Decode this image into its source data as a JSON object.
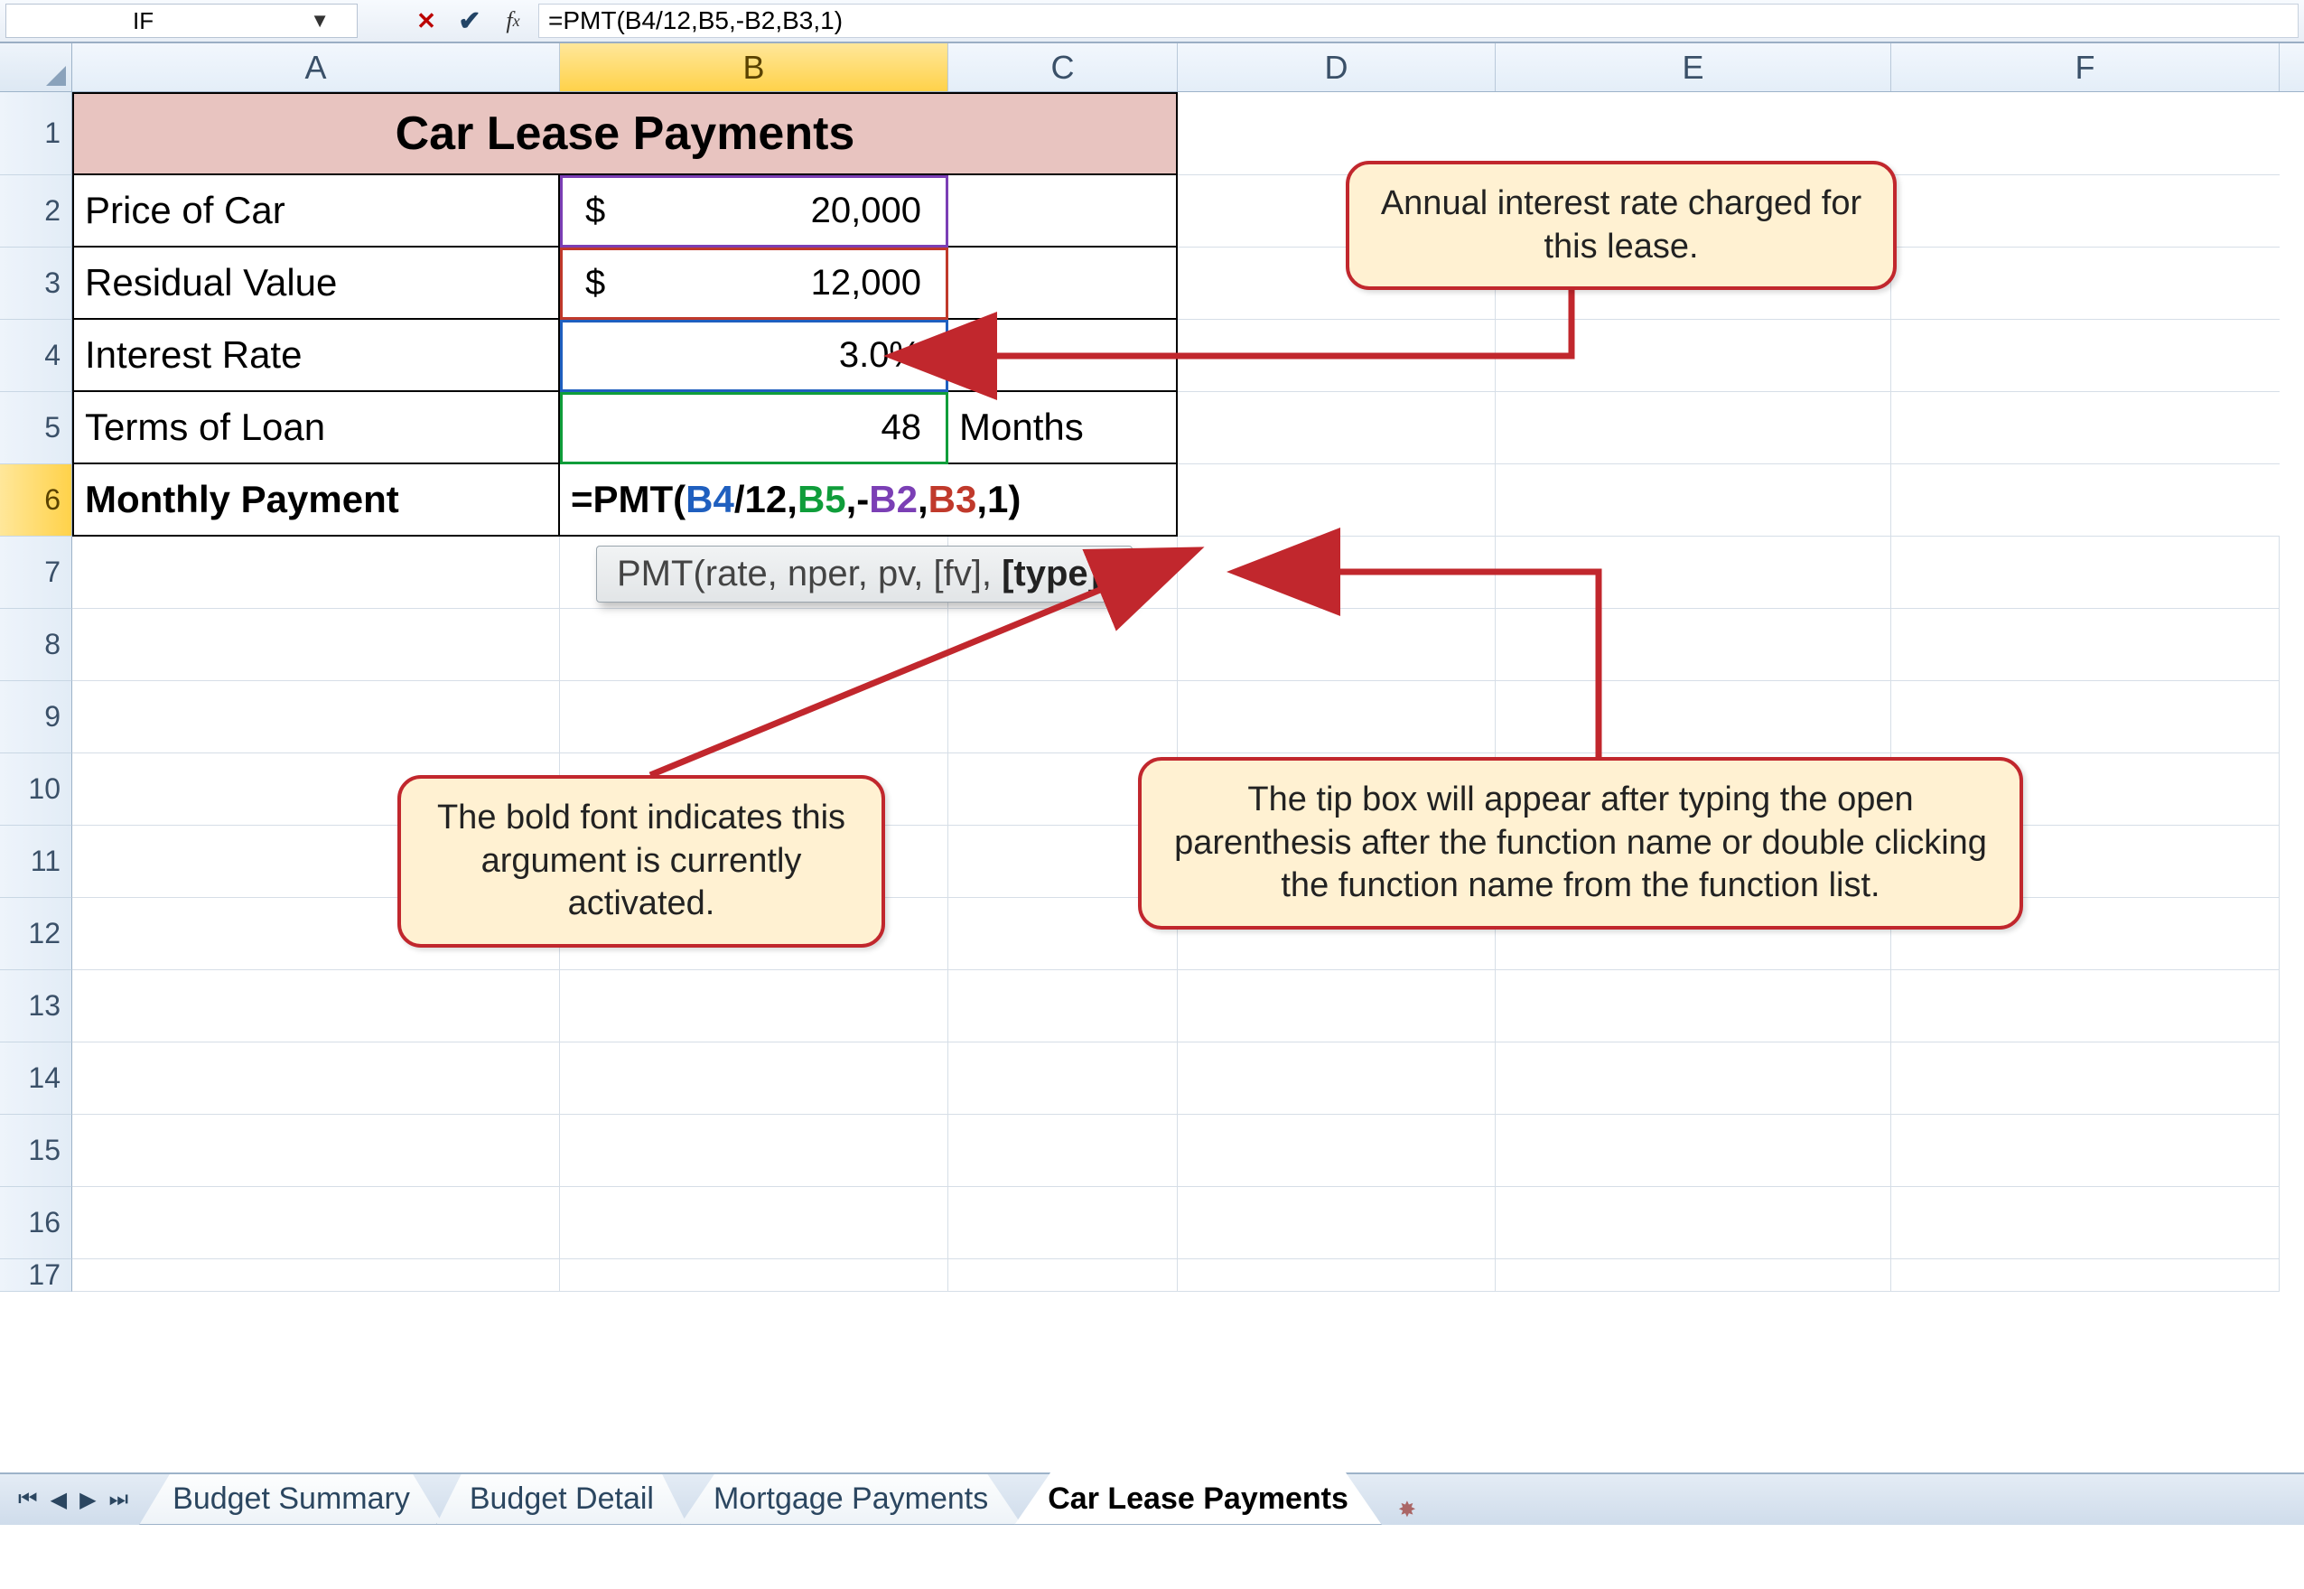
{
  "formula_bar": {
    "name_box": "IF",
    "formula": "=PMT(B4/12,B5,-B2,B3,1)"
  },
  "columns": [
    "A",
    "B",
    "C",
    "D",
    "E",
    "F"
  ],
  "rows": [
    "1",
    "2",
    "3",
    "4",
    "5",
    "6",
    "7",
    "8",
    "9",
    "10",
    "11",
    "12",
    "13",
    "14",
    "15",
    "16",
    "17"
  ],
  "table": {
    "title": "Car Lease Payments",
    "r2": {
      "label": "Price of Car",
      "currency": "$",
      "value": "20,000"
    },
    "r3": {
      "label": "Residual Value",
      "currency": "$",
      "value": "12,000"
    },
    "r4": {
      "label": "Interest Rate",
      "value": "3.0%"
    },
    "r5": {
      "label": "Terms of Loan",
      "value": "48",
      "unit": "Months"
    },
    "r6": {
      "label": "Monthly Payment"
    }
  },
  "formula_cell": {
    "prefix": "=PMT(",
    "b4": "B4",
    "sep1": "/12,",
    "b5": "B5",
    "sep2": ",-",
    "b2": "B2",
    "sep3": ",",
    "b3": "B3",
    "suffix": ",1)"
  },
  "tooltip": {
    "fn": "PMT",
    "args_plain": "(rate, nper, pv, [fv], ",
    "arg_bold": "[type]",
    "close": ")"
  },
  "callouts": {
    "c1": "Annual interest rate charged for this lease.",
    "c2": "The bold font indicates this argument is currently activated.",
    "c3": "The tip box will appear after typing the open parenthesis after the function name or double clicking the function name from the function list."
  },
  "tabs": {
    "t1": "Budget Summary",
    "t2": "Budget Detail",
    "t3": "Mortgage Payments",
    "t4": "Car Lease Payments"
  },
  "chart_data": {
    "type": "table",
    "title": "Car Lease Payments",
    "rows": [
      {
        "label": "Price of Car",
        "value": 20000,
        "format": "currency"
      },
      {
        "label": "Residual Value",
        "value": 12000,
        "format": "currency"
      },
      {
        "label": "Interest Rate",
        "value": 0.03,
        "format": "percent"
      },
      {
        "label": "Terms of Loan",
        "value": 48,
        "unit": "Months"
      },
      {
        "label": "Monthly Payment",
        "formula": "=PMT(B4/12,B5,-B2,B3,1)"
      }
    ]
  }
}
